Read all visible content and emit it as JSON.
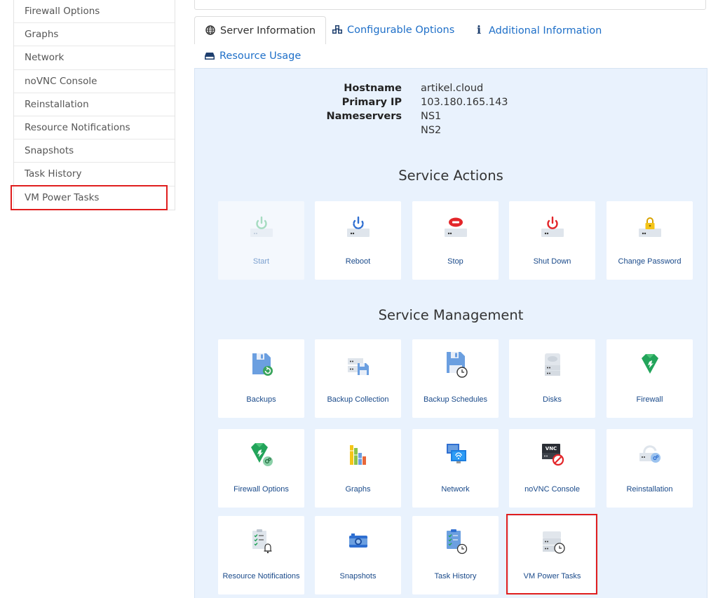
{
  "sidebar": {
    "items": [
      {
        "label": "Firewall Options"
      },
      {
        "label": "Graphs"
      },
      {
        "label": "Network"
      },
      {
        "label": "noVNC Console"
      },
      {
        "label": "Reinstallation"
      },
      {
        "label": "Resource Notifications"
      },
      {
        "label": "Snapshots"
      },
      {
        "label": "Task History"
      },
      {
        "label": "VM Power Tasks"
      }
    ]
  },
  "tabs": [
    {
      "label": "Server Information",
      "icon": "globe-icon",
      "active": true
    },
    {
      "label": "Configurable Options",
      "icon": "cubes-icon",
      "active": false
    },
    {
      "label": "Additional Information",
      "icon": "info-icon",
      "active": false
    },
    {
      "label": "Resource Usage",
      "icon": "hdd-icon",
      "active": false
    }
  ],
  "server_info": {
    "hostname_label": "Hostname",
    "hostname": "artikel.cloud",
    "primary_ip_label": "Primary IP",
    "primary_ip": "103.180.165.143",
    "nameservers_label": "Nameservers",
    "ns1": "NS1",
    "ns2": "NS2"
  },
  "service_actions": {
    "title": "Service Actions",
    "cards": [
      {
        "label": "Start",
        "icon": "power-start-icon",
        "disabled": true
      },
      {
        "label": "Reboot",
        "icon": "reboot-icon",
        "disabled": false
      },
      {
        "label": "Stop",
        "icon": "stop-icon",
        "disabled": false
      },
      {
        "label": "Shut Down",
        "icon": "shutdown-icon",
        "disabled": false
      },
      {
        "label": "Change Password",
        "icon": "lock-icon",
        "disabled": false
      }
    ]
  },
  "service_management": {
    "title": "Service Management",
    "cards": [
      {
        "label": "Backups",
        "icon": "backups-icon"
      },
      {
        "label": "Backup Collection",
        "icon": "backup-collection-icon"
      },
      {
        "label": "Backup Schedules",
        "icon": "backup-schedules-icon"
      },
      {
        "label": "Disks",
        "icon": "disks-icon"
      },
      {
        "label": "Firewall",
        "icon": "firewall-icon"
      },
      {
        "label": "Firewall Options",
        "icon": "firewall-options-icon"
      },
      {
        "label": "Graphs",
        "icon": "graphs-icon"
      },
      {
        "label": "Network",
        "icon": "network-icon"
      },
      {
        "label": "noVNC Console",
        "icon": "vnc-icon"
      },
      {
        "label": "Reinstallation",
        "icon": "reinstall-icon"
      },
      {
        "label": "Resource Notifications",
        "icon": "notifications-icon"
      },
      {
        "label": "Snapshots",
        "icon": "camera-icon"
      },
      {
        "label": "Task History",
        "icon": "task-history-icon"
      },
      {
        "label": "VM Power Tasks",
        "icon": "vm-power-tasks-icon"
      }
    ]
  },
  "colors": {
    "accent": "#1e6fc8",
    "panel_bg": "#e9f2fd",
    "highlight": "#e01e1e"
  }
}
